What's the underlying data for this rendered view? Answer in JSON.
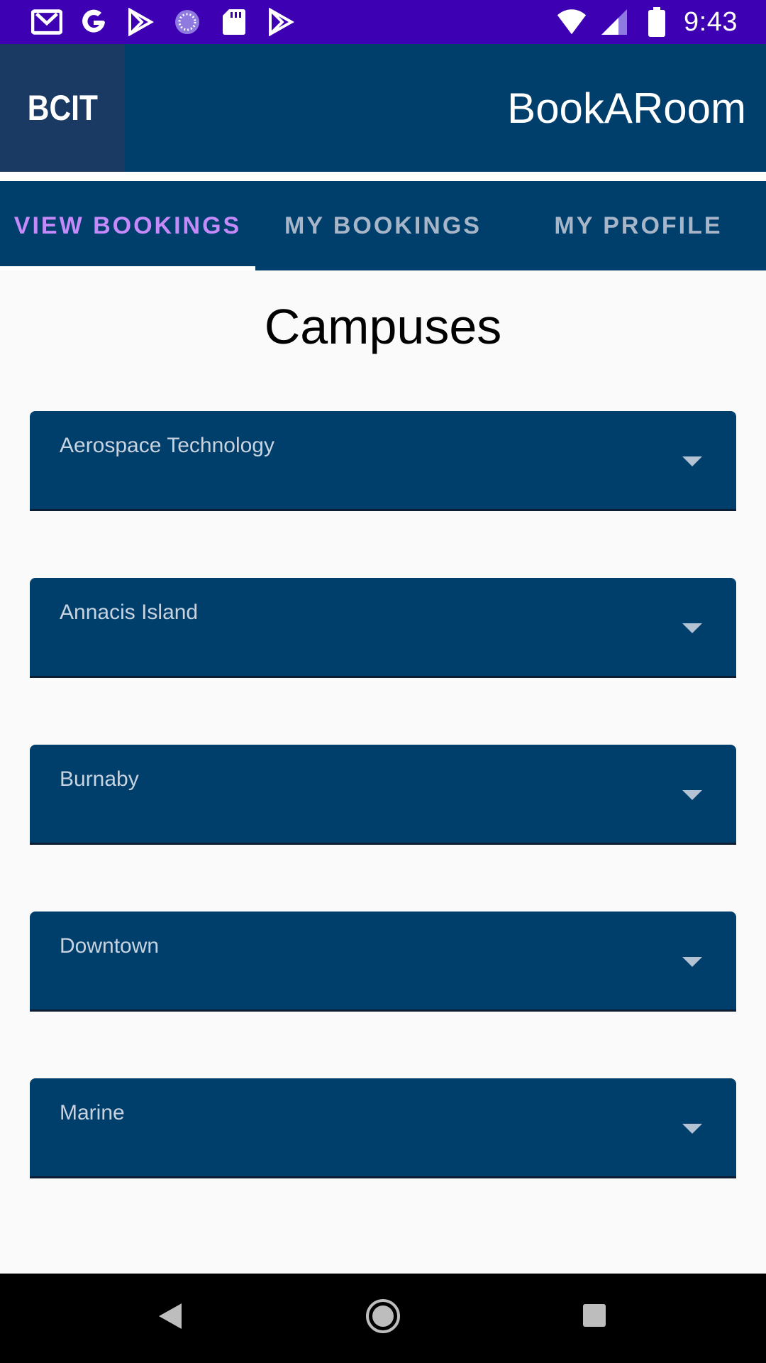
{
  "status_bar": {
    "time": "9:43",
    "left_icons": [
      "gmail-icon",
      "google-icon",
      "play-store-icon",
      "loading-icon",
      "sd-card-icon",
      "play-store-icon"
    ],
    "right_icons": [
      "wifi-icon",
      "signal-icon",
      "battery-icon"
    ],
    "background": "#3d00b3"
  },
  "app_bar": {
    "logo": "BCIT",
    "title": "BookARoom",
    "background": "#003e6b"
  },
  "tabs": [
    {
      "label": "VIEW BOOKINGS",
      "active": true
    },
    {
      "label": "MY BOOKINGS",
      "active": false
    },
    {
      "label": "MY PROFILE",
      "active": false
    }
  ],
  "main": {
    "heading": "Campuses",
    "campuses": [
      {
        "label": "Aerospace Technology"
      },
      {
        "label": "Annacis Island"
      },
      {
        "label": "Burnaby"
      },
      {
        "label": "Downtown"
      },
      {
        "label": "Marine"
      }
    ]
  },
  "nav_bar": {
    "buttons": [
      "back-icon",
      "home-icon",
      "recents-icon"
    ]
  },
  "colors": {
    "accent": "#c58af9",
    "primary": "#003e6b"
  }
}
